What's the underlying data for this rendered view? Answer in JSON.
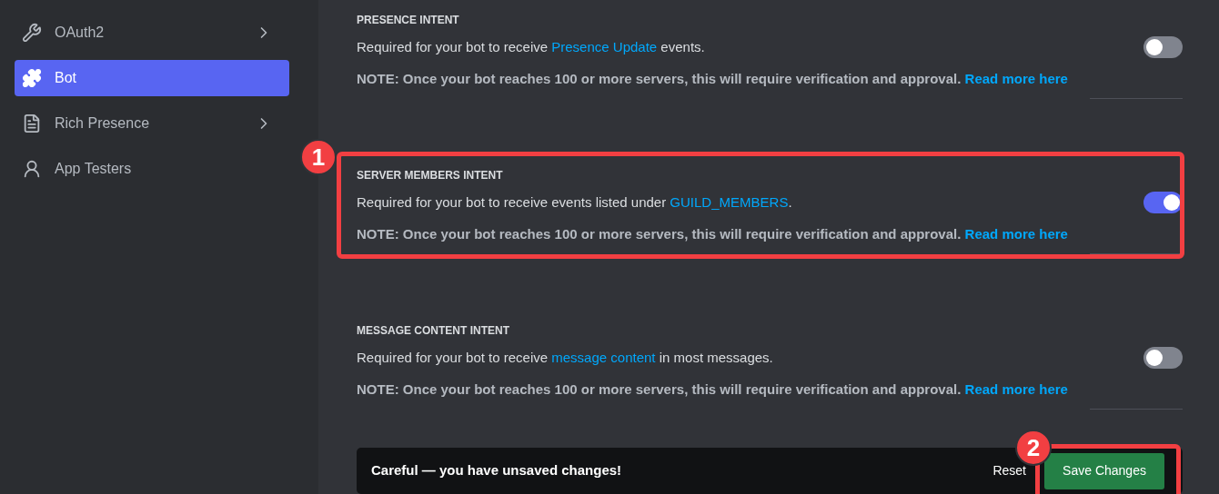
{
  "sidebar": {
    "items": [
      {
        "label": "OAuth2",
        "selected": false,
        "has_submenu": true
      },
      {
        "label": "Bot",
        "selected": true,
        "has_submenu": false
      },
      {
        "label": "Rich Presence",
        "selected": false,
        "has_submenu": true
      },
      {
        "label": "App Testers",
        "selected": false,
        "has_submenu": false
      }
    ]
  },
  "intents": [
    {
      "title": "PRESENCE INTENT",
      "description_before": "Required for your bot to receive ",
      "description_link": "Presence Update",
      "description_after": " events.",
      "note": "NOTE: Once your bot reaches 100 or more servers, this will require verification and approval.",
      "note_link": "Read more here",
      "on": false
    },
    {
      "title": "SERVER MEMBERS INTENT",
      "description_before": "Required for your bot to receive events listed under ",
      "description_link": "GUILD_MEMBERS",
      "description_after": ".",
      "note": "NOTE: Once your bot reaches 100 or more servers, this will require verification and approval.",
      "note_link": "Read more here",
      "on": true,
      "annotation": "1"
    },
    {
      "title": "MESSAGE CONTENT INTENT",
      "description_before": "Required for your bot to receive ",
      "description_link": "message content",
      "description_after": " in most messages.",
      "note": "NOTE: Once your bot reaches 100 or more servers, this will require verification and approval.",
      "note_link": "Read more here",
      "on": false
    }
  ],
  "save_bar": {
    "message": "Careful — you have unsaved changes!",
    "reset": "Reset",
    "save": "Save Changes",
    "save_annotation": "2"
  }
}
